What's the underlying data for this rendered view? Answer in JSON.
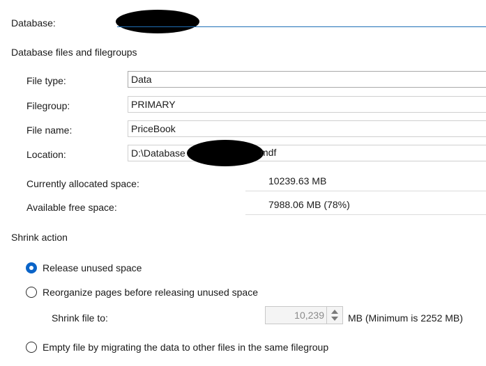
{
  "database": {
    "label": "Database:"
  },
  "files_section": {
    "title": "Database files and filegroups",
    "file_type": {
      "label": "File type:",
      "value": "Data"
    },
    "filegroup": {
      "label": "Filegroup:",
      "value": "PRIMARY"
    },
    "file_name": {
      "label": "File name:",
      "value": "PriceBook"
    },
    "location": {
      "label": "Location:",
      "value_prefix": "D:\\Database",
      "value_suffix": "mdf"
    },
    "allocated": {
      "label": "Currently allocated space:",
      "value": "10239.63 MB"
    },
    "free": {
      "label": "Available free space:",
      "value": "7988.06 MB (78%)"
    }
  },
  "shrink_action": {
    "title": "Shrink action",
    "options": [
      {
        "label": "Release unused space",
        "selected": true
      },
      {
        "label": "Reorganize pages before releasing unused space",
        "selected": false
      },
      {
        "label": "Empty file by migrating the data to other files in the same filegroup",
        "selected": false
      }
    ],
    "shrink_to": {
      "label": "Shrink file to:",
      "value": "10,239",
      "unit": "MB (Minimum is 2252 MB)"
    }
  },
  "colors": {
    "accent": "#0a64c8",
    "underline": "#1f6fb6"
  }
}
